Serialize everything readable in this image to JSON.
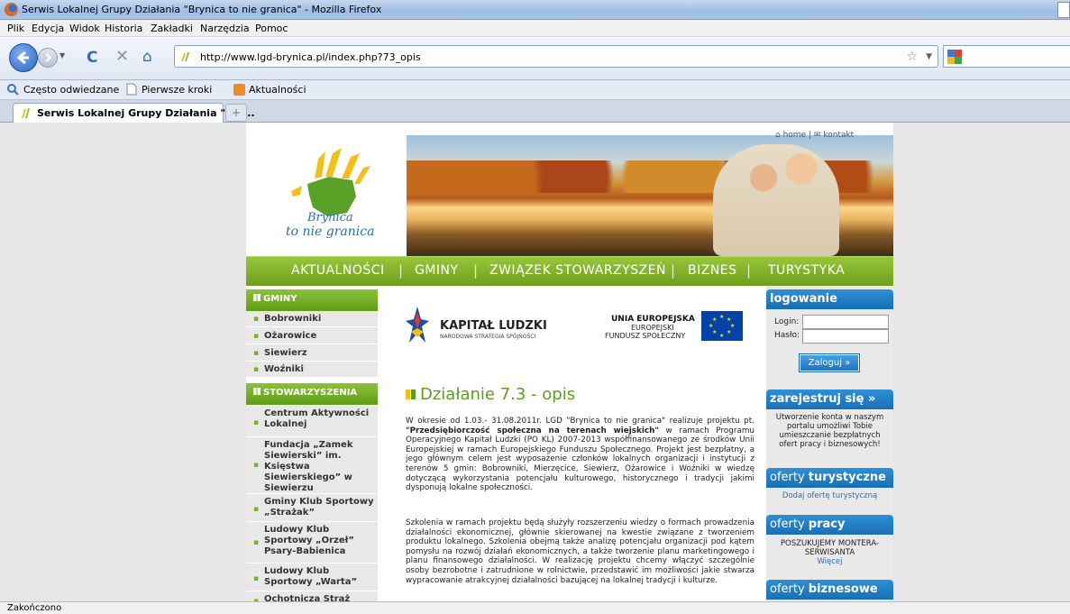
{
  "window": {
    "title": "Serwis Lokalnej Grupy Działania \"Brynica to nie granica\" - Mozilla Firefox"
  },
  "menu": [
    "Plik",
    "Edycja",
    "Widok",
    "Historia",
    "Zakładki",
    "Narzędzia",
    "Pomoc"
  ],
  "address": {
    "url": "http://www.lgd-brynica.pl/index.php?73_opis"
  },
  "bookmarks": [
    "Często odwiedzane",
    "Pierwsze kroki",
    "Aktualności"
  ],
  "tab": {
    "title": "Serwis Lokalnej Grupy Działania \"Bry...",
    "new_tab": "+"
  },
  "status": "Zakończono",
  "page": {
    "logo": {
      "line1": "Brynica",
      "line2": "to nie granica"
    },
    "toplinks": {
      "home": "home",
      "separator": "|",
      "contact": "kontakt"
    },
    "nav": [
      "AKTUALNOŚCI",
      "GMINY",
      "ZWIĄZEK STOWARZYSZEŃ",
      "BIZNES",
      "TURYSTYKA"
    ],
    "nav_separator": "|",
    "left": {
      "gminy_heading": "GMINY",
      "gminy": [
        "Bobrowniki",
        "Ożarowice",
        "Siewierz",
        "Woźniki"
      ],
      "stow_heading": "STOWARZYSZENIA",
      "stow": [
        "Centrum Aktywności Lokalnej",
        "Fundacja „Zamek Siewierski” im. Księstwa Siewierskiego” w Siewierzu",
        "Gminy Klub Sportowy „Strażak”",
        "Ludowy Klub Sportowy „Orzeł” Psary-Babienica",
        "Ludowy Klub Sportowy „Warta”",
        "Ochotnicza Straż"
      ]
    },
    "eu": {
      "kl_title": "KAPITAŁ LUDZKI",
      "kl_sub": "NARODOWA STRATEGIA SPÓJNOŚCI",
      "ue_title": "UNIA EUROPEJSKA",
      "ue_line2": "EUROPEJSKI",
      "ue_line3": "FUNDUSZ SPOŁECZNY"
    },
    "article": {
      "title": "Działanie 7.3 - opis",
      "p1_start": "W okresie od 1.03.- 31.08.2011r. LGD \"Brynica to nie granica\" realizuje projektu pt. ",
      "p1_bold": "\"Przedsiębiorczość społeczna na terenach wiejskich\"",
      "p1_rest": " w ramach Programu Operacyjnego Kapitał Ludzki (PO KL) 2007-2013 współfinansowanego ze środków Unii Europejskiej w ramach Europejskiego Funduszu Społecznego. Projekt jest bezpłatny, a jego głównym celem jest wyposażenie członków lokalnych organizacji i instytucji z terenów 5 gmin: Bobrowniki, Mierzęcice, Siewierz, Ożarowice i Woźniki w wiedzę dotyczącą wykorzystania potencjału kulturowego, historycznego i tradycji jakimi dysponują lokalne społeczności.",
      "p2": "Szkolenia w ramach projektu będą służyły rozszerzeniu wiedzy o formach prowadzenia działalności ekonomicznej, głównie skierowanej na kwestie związane z tworzeniem produktu lokalnego. Szkolenia obejmą także analizę potencjału organizacji pod kątem pomysłu na rozwój działań ekonomicznych, a także tworzenie planu marketingowego i planu finansowego działalności. W realizację projektu chcemy włączyć szczególnie osoby bezrobotne i zatrudnione w rolnictwie, przedstawić im możliwości jakie stwarza wypracowanie atrakcyjnej działalności bazującej na lokalnej tradycji i kulturze."
    },
    "right": {
      "login_heading": "logowanie",
      "login_label": "Login:",
      "password_label": "Hasło:",
      "login_button": "Zaloguj »",
      "register_heading": "zarejestruj się »",
      "register_text": "Utworzenie konta w naszym portalu umożliwi Tobie umieszczanie bezpłatnych ofert pracy i biznesowych!",
      "tour_light": "oferty ",
      "tour_bold": "turystyczne",
      "tour_link": "Dodaj ofertę turystyczną",
      "work_light": "oferty ",
      "work_bold": "pracy",
      "work_text": "POSZUKUJEMY MONTERA-SERWISANTA",
      "work_more": "Więcej",
      "biz_light": "oferty ",
      "biz_bold": "biznesowe"
    }
  }
}
